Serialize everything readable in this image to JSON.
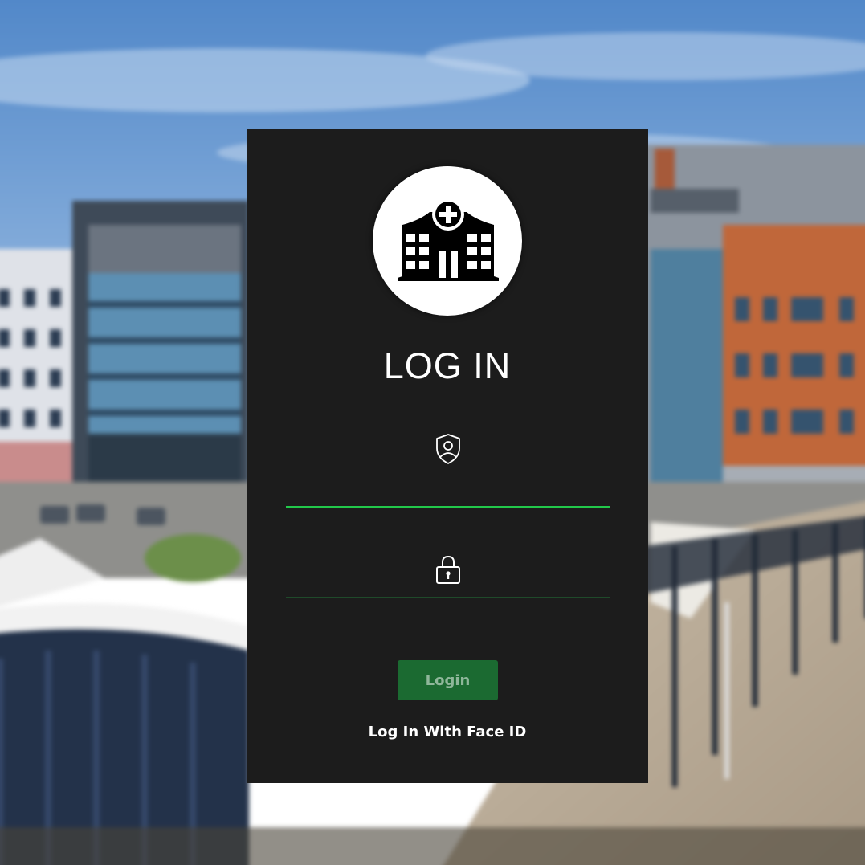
{
  "login": {
    "title": "LOG IN",
    "username": {
      "icon": "user-shield-icon",
      "value": "",
      "placeholder": ""
    },
    "password": {
      "icon": "lock-icon",
      "value": "",
      "placeholder": ""
    },
    "login_button_label": "Login",
    "face_id_label": "Log In With Face ID",
    "logo_icon": "hospital-icon"
  },
  "colors": {
    "card_background": "#1c1c1c",
    "accent_active": "#22c84a",
    "accent_inactive": "#1f4a2a",
    "button_background": "#1b6a31",
    "button_text": "#8fb79a"
  }
}
